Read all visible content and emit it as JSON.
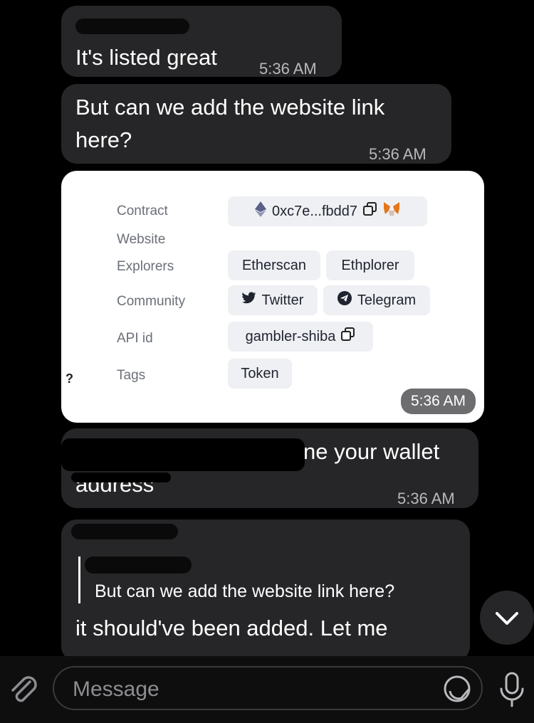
{
  "messages": [
    {
      "text": "It's listed great",
      "time": "5:36 AM"
    },
    {
      "text": "But can we add the website link here?",
      "time": "5:36 AM"
    },
    {
      "card_time": "5:36 AM"
    },
    {
      "text_visible_start": "ne your wallet",
      "text_visible_end": "address",
      "time": "5:36 AM"
    },
    {
      "reply_quote": "But can we add the website link here?",
      "text": "it should've been added. Let me"
    }
  ],
  "card": {
    "rows": [
      {
        "label": "Contract"
      },
      {
        "label": "Website"
      },
      {
        "label": "Explorers"
      },
      {
        "label": "Community"
      },
      {
        "label": "API id"
      },
      {
        "label": "Tags"
      }
    ],
    "contract_address": "0xc7e...fbdd7",
    "explorers": [
      "Etherscan",
      "Ethplorer"
    ],
    "community": [
      "Twitter",
      "Telegram"
    ],
    "api_id": "gambler-shiba",
    "tag": "Token",
    "side_mark": "?"
  },
  "composer": {
    "placeholder": "Message"
  },
  "icons": {
    "attach": "paperclip-icon",
    "sticker": "sticker-icon",
    "mic": "microphone-icon",
    "scroll_down": "chevron-down-icon",
    "eth": "ethereum-icon",
    "copy": "copy-icon",
    "metamask": "metamask-icon",
    "twitter": "twitter-icon",
    "telegram": "telegram-icon"
  }
}
